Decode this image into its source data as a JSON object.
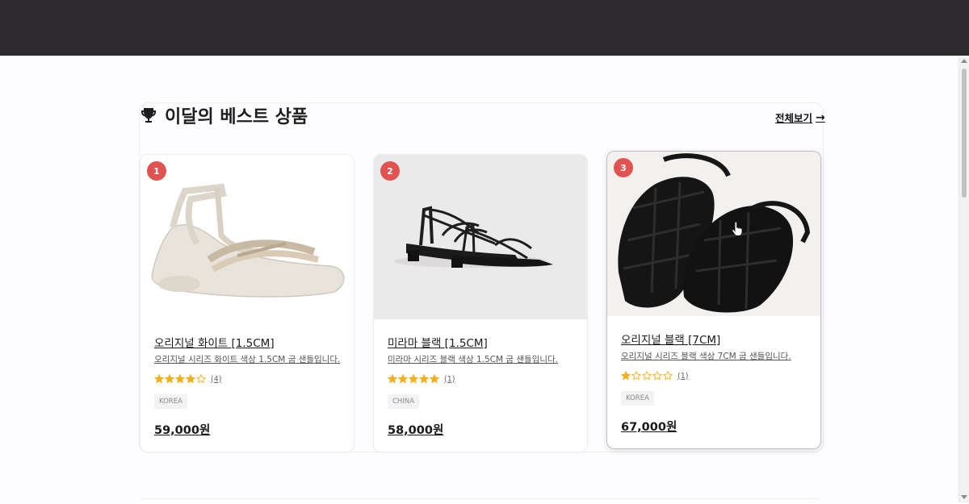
{
  "section": {
    "title": "이달의 베스트 상품",
    "title_icon": "trophy-icon",
    "view_all": "전체보기",
    "view_all_arrow": "→"
  },
  "products": [
    {
      "rank": "1",
      "name": "오리지널 화이트 [1.5CM]",
      "description": "오리지널 시리즈 화이트 색상 1.5CM 굽 샌들입니다.",
      "rating": 4,
      "review_count": "(4)",
      "origin": "KOREA",
      "price": "59,000원"
    },
    {
      "rank": "2",
      "name": "미라마 블랙 [1.5CM]",
      "description": "미라마 시리즈 블랙 색상 1.5CM 굽 샌들입니다.",
      "rating": 5,
      "review_count": "(1)",
      "origin": "CHINA",
      "price": "58,000원"
    },
    {
      "rank": "3",
      "name": "오리지널 블랙 [7CM]",
      "description": "오리지널 시리즈 블랙 색상 7CM 굽 샌들입니다.",
      "rating": 1,
      "review_count": "(1)",
      "origin": "KOREA",
      "price": "67,000원"
    }
  ],
  "colors": {
    "header_bg": "#2c2a2d",
    "rank_badge": "#e05350",
    "star": "#f2b01e"
  }
}
